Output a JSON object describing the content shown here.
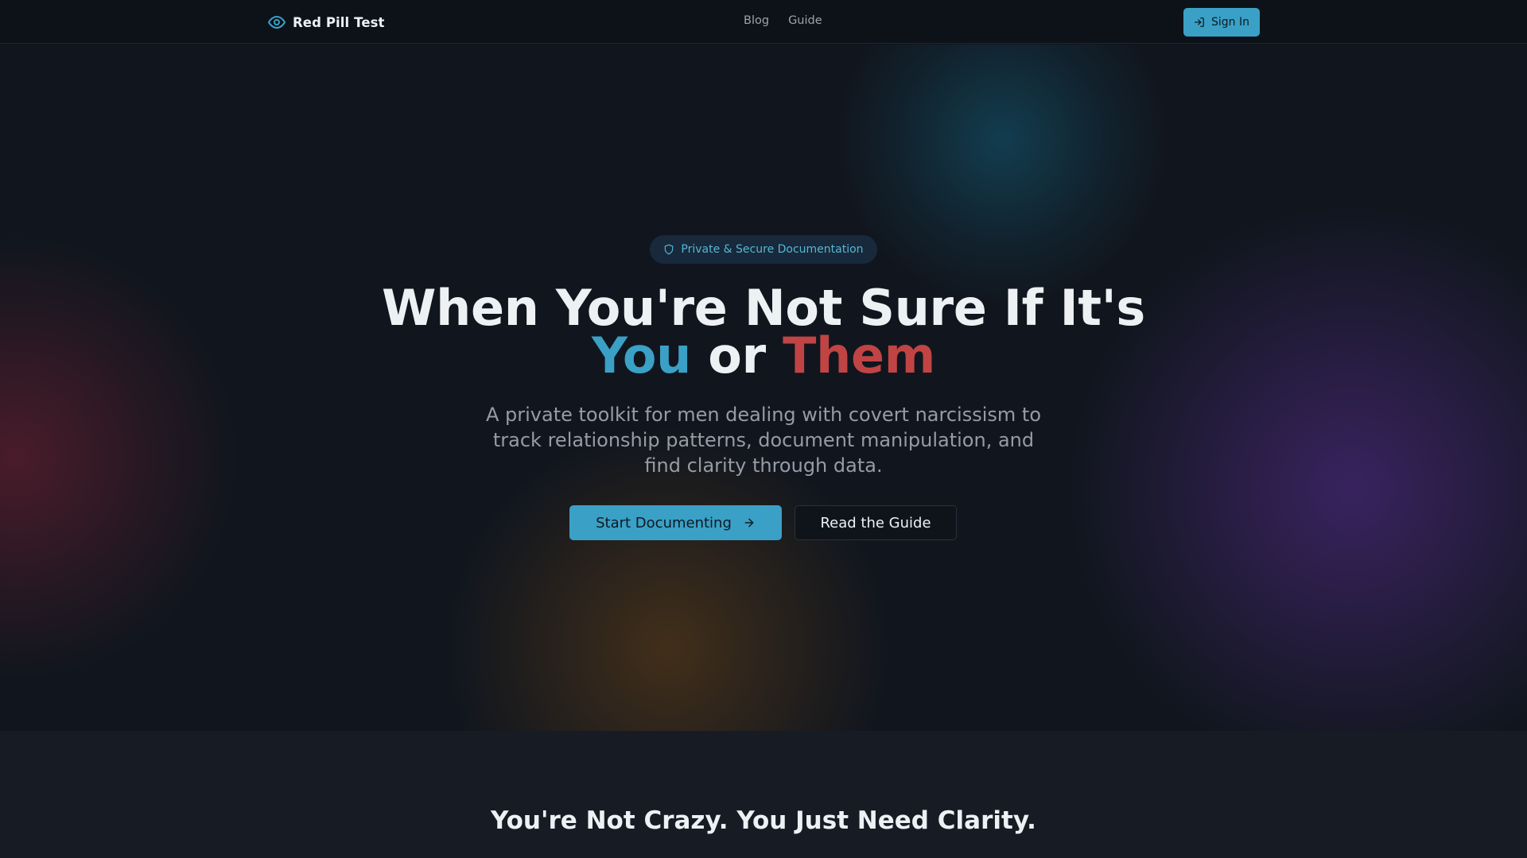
{
  "brand": {
    "name": "Red Pill Test",
    "icon": "eye-icon",
    "accent": "#3aa0c6"
  },
  "nav": {
    "links": [
      {
        "label": "Blog"
      },
      {
        "label": "Guide"
      }
    ],
    "sign_in": {
      "label": "Sign In",
      "icon": "log-in-icon"
    }
  },
  "hero": {
    "badge": {
      "label": "Private & Secure Documentation",
      "icon": "shield-icon"
    },
    "headline": {
      "line1": "When You're Not Sure If It's",
      "you": "You",
      "or": "or",
      "them": "Them",
      "you_color": "#3aa0c6",
      "them_color": "#c04444"
    },
    "subtitle": "A private toolkit for men dealing with covert narcissism to track relationship patterns, document manipulation, and find clarity through data.",
    "cta_primary": {
      "label": "Start Documenting",
      "icon": "arrow-right-icon"
    },
    "cta_secondary": {
      "label": "Read the Guide"
    }
  },
  "section2": {
    "title": "You're Not Crazy. You Just Need Clarity."
  }
}
